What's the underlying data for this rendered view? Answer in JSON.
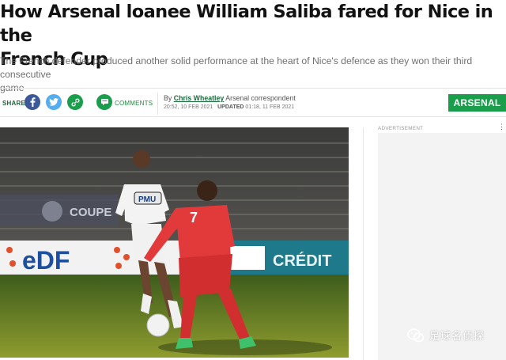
{
  "article": {
    "headline_line1": "How Arsenal loanee William Saliba fared for Nice in the",
    "headline_line2": "French Cup",
    "standfirst_line1": "The French defender produced another solid performance at the heart of Nice's defence as they won their third consecutive",
    "standfirst_line2": "game"
  },
  "share": {
    "label": "SHARE",
    "icons": [
      "facebook-icon",
      "twitter-icon",
      "link-icon"
    ],
    "comments_label": "COMMENTS",
    "colors": {
      "facebook": "#3b5998",
      "twitter": "#55acee",
      "link": "#1a9e4b",
      "comments": "#1a9e4b"
    }
  },
  "byline": {
    "by": "By",
    "author": "Chris Wheatley",
    "role": "Arsenal correspondent",
    "published": "20:52, 10 FEB 2021",
    "updated_label": "UPDATED",
    "updated": "01:18, 11 FEB 2021"
  },
  "section_tag": {
    "label": "ARSENAL",
    "color": "#1a9e4b"
  },
  "photo": {
    "boards": {
      "coupe": "COUPE",
      "edf": "eDF",
      "credit": "CRÉDIT"
    },
    "sponsor": "PMU",
    "player_number": "7"
  },
  "sidebar": {
    "ad_label": "ADVERTISEMENT",
    "dots": "⋮"
  },
  "watermark": {
    "text": "足球名侦探"
  }
}
